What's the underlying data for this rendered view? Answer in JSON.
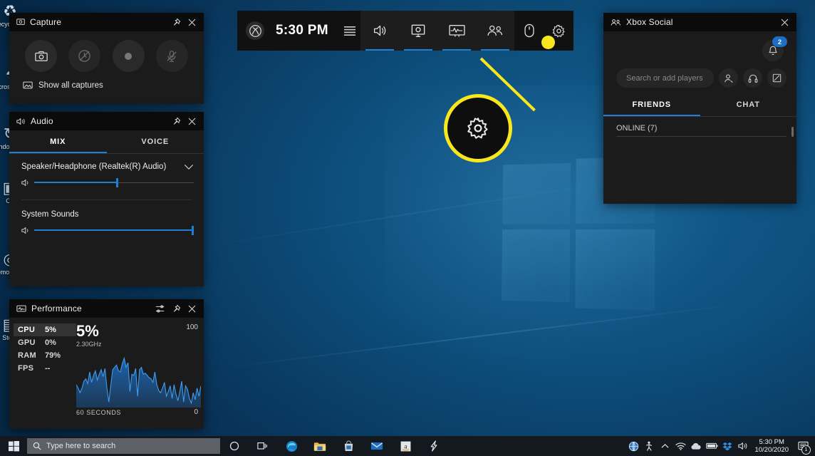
{
  "desktop": {
    "icons": [
      {
        "name": "Recycle Bin",
        "glyph": "♻"
      },
      {
        "name": "Microsoft Edge",
        "glyph": "◔"
      },
      {
        "name": "Windows Update",
        "glyph": "↻"
      },
      {
        "name": "C:\\",
        "glyph": "▣"
      },
      {
        "name": "Remote App",
        "glyph": "◎"
      },
      {
        "name": "Store",
        "glyph": "▤"
      }
    ]
  },
  "gamebar": {
    "xbox_logo_icon": "xbox-logo-icon",
    "time": "5:30 PM",
    "menu_icon": "menu-icon",
    "buttons": [
      {
        "name": "audio",
        "icon": "speaker-icon",
        "active": true
      },
      {
        "name": "capture",
        "icon": "capture-widget-icon",
        "active": true
      },
      {
        "name": "performance",
        "icon": "performance-monitor-icon",
        "active": true
      },
      {
        "name": "xbox-social",
        "icon": "people-icon",
        "active": true
      }
    ],
    "right_buttons": [
      {
        "name": "widget-store",
        "icon": "mouse-icon"
      },
      {
        "name": "settings",
        "icon": "gear-icon"
      }
    ]
  },
  "callout": {
    "icon": "gear-icon",
    "color": "#f8e71c"
  },
  "capture": {
    "title": "Capture",
    "title_icon": "capture-widget-icon",
    "pin_icon": "pin-icon",
    "close_icon": "close-icon",
    "buttons": [
      {
        "name": "take-screenshot",
        "icon": "camera-icon",
        "disabled": false
      },
      {
        "name": "record-last-30-seconds",
        "icon": "record-last-icon",
        "disabled": true
      },
      {
        "name": "start-recording",
        "icon": "record-dot-icon",
        "disabled": false
      },
      {
        "name": "toggle-microphone",
        "icon": "mic-muted-icon",
        "disabled": true
      }
    ],
    "show_all_label": "Show all captures",
    "show_all_icon": "gallery-icon"
  },
  "audio": {
    "title": "Audio",
    "title_icon": "speaker-icon",
    "pin_icon": "pin-icon",
    "close_icon": "close-icon",
    "tabs": [
      {
        "label": "MIX",
        "active": true
      },
      {
        "label": "VOICE",
        "active": false
      }
    ],
    "device": {
      "label": "Speaker/Headphone (Realtek(R) Audio)",
      "chevron_icon": "chevron-down-icon",
      "volume_icon": "speaker-icon",
      "volume_percent": 52
    },
    "system_sounds": {
      "label": "System Sounds",
      "volume_icon": "speaker-icon",
      "volume_percent": 100
    }
  },
  "performance": {
    "title": "Performance",
    "title_icon": "performance-monitor-icon",
    "settings_icon": "sliders-icon",
    "pin_icon": "pin-icon",
    "close_icon": "close-icon",
    "stats": [
      {
        "key": "CPU",
        "value": "5%",
        "selected": true
      },
      {
        "key": "GPU",
        "value": "0%",
        "selected": false
      },
      {
        "key": "RAM",
        "value": "79%",
        "selected": false
      },
      {
        "key": "FPS",
        "value": "--",
        "selected": false
      }
    ],
    "big_value": "5%",
    "clock_speed": "2.30GHz",
    "axis_max": "100",
    "axis_min": "0",
    "axis_label": "60 SECONDS",
    "graph_color": "#1e6fc4",
    "graph_points": [
      36,
      30,
      22,
      30,
      42,
      46,
      38,
      58,
      40,
      52,
      60,
      44,
      54,
      62,
      50,
      64,
      30,
      6,
      34,
      62,
      66,
      70,
      60,
      58,
      72,
      82,
      66,
      74,
      24,
      54,
      52,
      64,
      16,
      62,
      66,
      54,
      56,
      52,
      48,
      46,
      40,
      58,
      36,
      26,
      22,
      30,
      40,
      16,
      24,
      34,
      12,
      36,
      20,
      8,
      24,
      42,
      6,
      34,
      28,
      12,
      4,
      22,
      10,
      30,
      16,
      34
    ]
  },
  "social": {
    "title": "Xbox Social",
    "title_icon": "people-icon",
    "close_icon": "close-icon",
    "notifications": {
      "icon": "bell-icon",
      "count": "2"
    },
    "search_placeholder": "Search or add players",
    "actions": [
      {
        "name": "add-friend",
        "icon": "add-person-icon"
      },
      {
        "name": "start-party",
        "icon": "headset-icon"
      },
      {
        "name": "new-message",
        "icon": "compose-icon"
      }
    ],
    "tabs": [
      {
        "label": "FRIENDS",
        "active": true
      },
      {
        "label": "CHAT",
        "active": false
      }
    ],
    "online_header": "ONLINE (7)"
  },
  "taskbar": {
    "start_icon": "windows-start-icon",
    "search_icon": "search-icon",
    "search_placeholder": "Type here to search",
    "apps": [
      {
        "name": "cortana",
        "icon": "cortana-circle-icon"
      },
      {
        "name": "task-view",
        "icon": "task-view-icon"
      },
      {
        "name": "microsoft-edge",
        "icon": "edge-icon"
      },
      {
        "name": "file-explorer",
        "icon": "folder-icon"
      },
      {
        "name": "microsoft-store",
        "icon": "store-bag-icon"
      },
      {
        "name": "mail",
        "icon": "mail-icon"
      },
      {
        "name": "amazon",
        "icon": "amazon-icon"
      },
      {
        "name": "sketchable",
        "icon": "lightning-icon"
      }
    ],
    "tray": [
      {
        "name": "help-globe",
        "icon": "globe-icon"
      },
      {
        "name": "accessibility",
        "icon": "person-running-icon"
      },
      {
        "name": "show-hidden-icons",
        "icon": "chevron-up-icon"
      },
      {
        "name": "network",
        "icon": "wifi-icon"
      },
      {
        "name": "onedrive",
        "icon": "cloud-icon"
      },
      {
        "name": "battery",
        "icon": "battery-icon"
      },
      {
        "name": "dropbox",
        "icon": "dropbox-icon"
      },
      {
        "name": "volume",
        "icon": "speaker-icon"
      }
    ],
    "clock": {
      "time": "5:30 PM",
      "date": "10/20/2020"
    },
    "notification_center": {
      "icon": "notification-icon",
      "count": "1"
    }
  }
}
